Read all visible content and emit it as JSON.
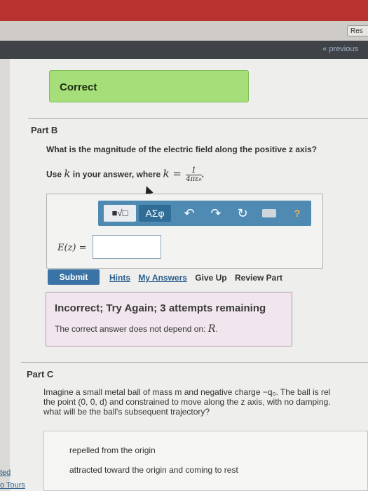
{
  "header": {
    "res_label": "Res",
    "previous_link": "« previous"
  },
  "feedback_part_a": {
    "label": "Correct"
  },
  "part_b": {
    "title": "Part B",
    "question": "What is the magnitude of the electric field along the positive z axis?",
    "use_k_prefix": "Use",
    "use_k_var": "k",
    "use_k_middle": "in your answer, where",
    "use_k_eq": "k =",
    "frac_num": "1",
    "frac_den": "4πε₀",
    "toolbar": {
      "template_label": "■√□",
      "greek_label": "ΑΣφ",
      "undo_icon": "↶",
      "redo_icon": "↷",
      "reset_icon": "↻",
      "help_label": "?"
    },
    "answer_label": "E(z) =",
    "answer_value": "",
    "submit_label": "Submit",
    "links": {
      "hints": "Hints",
      "my_answers": "My Answers",
      "give_up": "Give Up",
      "review_part": "Review Part"
    },
    "incorrect_title": "Incorrect; Try Again; 3 attempts remaining",
    "incorrect_msg_prefix": "The correct answer does not depend on:",
    "incorrect_msg_var": "R"
  },
  "part_c": {
    "title": "Part C",
    "q_line1": "Imagine a small metal ball of mass m and negative charge −q₀. The ball is rel",
    "q_line2": "the point (0, 0, d) and constrained to move along the z axis, with no damping.",
    "q_line3": "what will be the ball's subsequent trajectory?",
    "choice_1": "repelled from the origin",
    "choice_2": "attracted toward the origin and coming to rest"
  },
  "left_links": {
    "link_1": "ted",
    "link_2": "o Tours"
  }
}
